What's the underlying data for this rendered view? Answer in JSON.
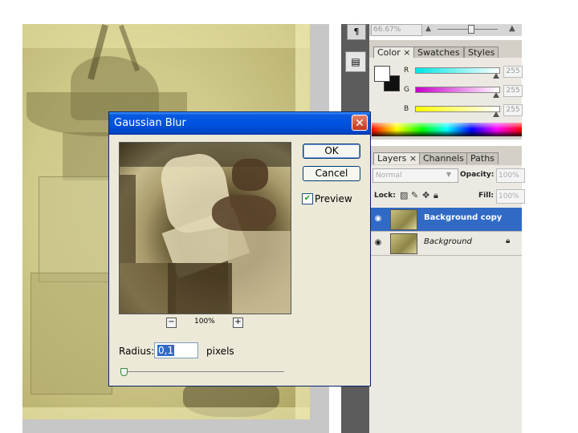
{
  "navigator": {
    "zoom": "66.67%"
  },
  "color_panel": {
    "tabs": [
      {
        "label": "Color ×"
      },
      {
        "label": "Swatches"
      },
      {
        "label": "Styles"
      }
    ],
    "channels": [
      {
        "label": "R",
        "value": "255",
        "color_from": "#ffffff",
        "color_to": "#00ffff"
      },
      {
        "label": "G",
        "value": "255",
        "color_from": "#ffffff",
        "color_to": "#c800c8"
      },
      {
        "label": "B",
        "value": "255",
        "color_from": "#ffffff",
        "color_to": "#ffff00"
      }
    ]
  },
  "layers_panel": {
    "tabs": [
      {
        "label": "Layers ×"
      },
      {
        "label": "Channels"
      },
      {
        "label": "Paths"
      }
    ],
    "blend_mode": "Normal",
    "opacity_label": "Opacity:",
    "opacity_value": "100%",
    "lock_label": "Lock:",
    "fill_label": "Fill:",
    "fill_value": "100%",
    "layers": [
      {
        "name": "Background copy",
        "selected": true
      },
      {
        "name": "Background",
        "selected": false,
        "locked": true
      }
    ]
  },
  "dialog": {
    "title": "Gaussian Blur",
    "ok_label": "OK",
    "cancel_label": "Cancel",
    "preview_label": "Preview",
    "preview_checked": true,
    "zoom_level": "100%",
    "radius_label": "Radius:",
    "radius_value": "0,1",
    "radius_unit": "pixels"
  },
  "colors": {
    "title_bar": "#0053e1",
    "selection": "#316ac5",
    "dialog_bg": "#ece9d8"
  }
}
